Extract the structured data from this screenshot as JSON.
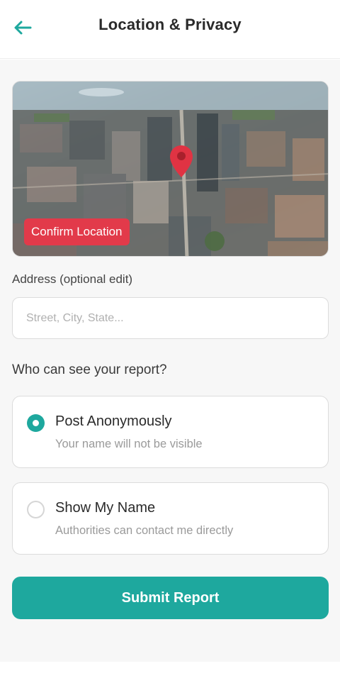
{
  "header": {
    "title": "Location & Privacy",
    "back_icon": "arrow-left-icon"
  },
  "colors": {
    "accent": "#1ea89e",
    "danger": "#e23a4a",
    "pin": "#e03343"
  },
  "map": {
    "confirm_label": "Confirm Location",
    "pin_icon": "map-pin-icon"
  },
  "address": {
    "label": "Address (optional edit)",
    "placeholder": "Street, City, State...",
    "value": ""
  },
  "visibility": {
    "question": "Who can see your report?",
    "options": [
      {
        "title": "Post Anonymously",
        "description": "Your name will not be visible",
        "selected": true
      },
      {
        "title": "Show My Name",
        "description": "Authorities can contact me directly",
        "selected": false
      }
    ]
  },
  "submit_label": "Submit Report"
}
